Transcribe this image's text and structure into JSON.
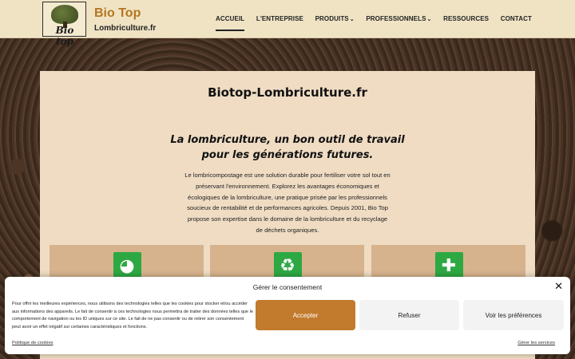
{
  "header": {
    "logo_text": "Bio top",
    "brand_title": "Bio Top",
    "brand_subtitle": "Lombriculture.fr",
    "nav": [
      {
        "label": "ACCUEIL",
        "active": true
      },
      {
        "label": "L'ENTREPRISE",
        "active": false
      },
      {
        "label": "PRODUITS",
        "dropdown": true
      },
      {
        "label": "PROFESSIONNELS",
        "dropdown": true
      },
      {
        "label": "RESSOURCES",
        "active": false
      },
      {
        "label": "CONTACT",
        "active": false
      }
    ]
  },
  "main": {
    "title": "Biotop-Lombriculture.fr",
    "tagline_line1": "La lombriculture, un bon outil de travail",
    "tagline_line2": "pour les générations futures.",
    "intro": "Le lombricompostage est une solution durable pour fertiliser votre sol tout en préservant l'environnement. Explorez les avantages économiques et écologiques de la lombriculture, une pratique prisée par les professionnels soucieux de rentabilité et de performances agricoles. Depuis 2001, Bio Top propose son expertise dans le domaine de la lombriculture et du recyclage de déchets organiques.",
    "tiles": [
      {
        "icon": "globe-icon",
        "glyph": "◕"
      },
      {
        "icon": "recycle-icon",
        "glyph": "♻"
      },
      {
        "icon": "puzzle-icon",
        "glyph": "✚"
      }
    ],
    "accent_color": "#2ea843"
  },
  "cookie_banner": {
    "title": "Gérer le consentement",
    "text": "Pour offrir les meilleures expériences, nous utilisons des technologies telles que les cookies pour stocker et/ou accéder aux informations des appareils. Le fait de consentir à ces technologies nous permettra de traiter des données telles que le comportement de navigation ou les ID uniques sur ce site. Le fait de ne pas consentir ou de retirer son consentement peut avoir un effet négatif sur certaines caractéristiques et fonctions.",
    "accept_label": "Accepter",
    "refuse_label": "Refuser",
    "prefs_label": "Voir les préférences",
    "policy_link": "Politique de cookies",
    "services_link": "Gérer les services",
    "close_glyph": "✕",
    "accept_color": "#c27a2c"
  }
}
